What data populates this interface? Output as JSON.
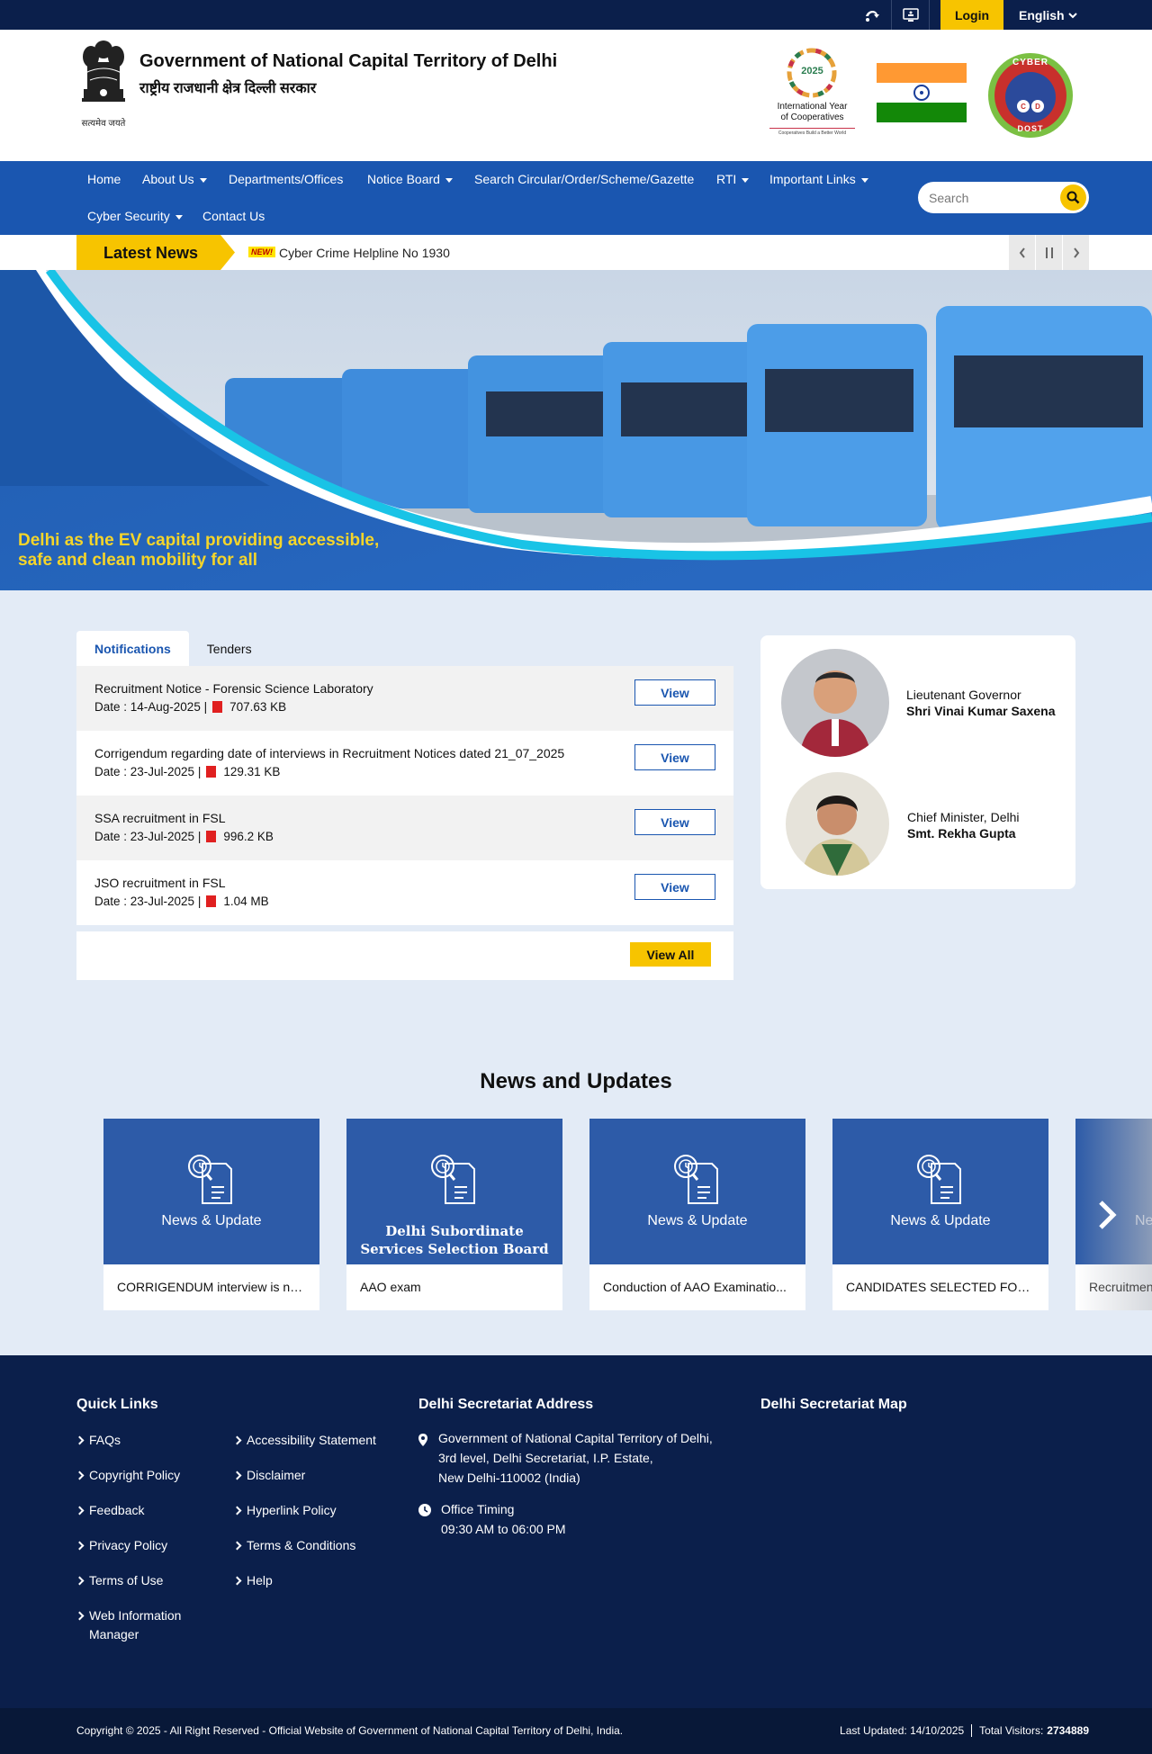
{
  "topbar": {
    "icons": [
      "screen-reader-icon",
      "accessibility-options-icon",
      "wheelchair-icon",
      "sitemap-icon"
    ],
    "login_label": "Login",
    "language_label": "English"
  },
  "header": {
    "title": "Government of National Capital Territory of Delhi",
    "subtitle": "राष्ट्रीय राजधानी क्षेत्र दिल्ली सरकार",
    "emblem_motto": "सत्यमेव जयते",
    "iyc_year": "2025",
    "iyc_title_line1": "International Year",
    "iyc_title_line2": "of Cooperatives",
    "iyc_tagline": "Cooperatives Build a Better World",
    "cyber_logo_text_top": "CYBER",
    "cyber_logo_text_bottom": "DOST"
  },
  "nav": {
    "items": [
      {
        "label": "Home",
        "has_dropdown": false
      },
      {
        "label": "About Us",
        "has_dropdown": true
      },
      {
        "label": "Departments/Offices",
        "has_dropdown": false
      },
      {
        "label": "Notice Board",
        "has_dropdown": true
      },
      {
        "label": "Search Circular/Order/Scheme/Gazette",
        "has_dropdown": false
      },
      {
        "label": "RTI",
        "has_dropdown": true
      },
      {
        "label": "Important Links",
        "has_dropdown": true
      },
      {
        "label": "Cyber Security",
        "has_dropdown": true
      },
      {
        "label": "Contact Us",
        "has_dropdown": false
      }
    ],
    "search_placeholder": "Search"
  },
  "ticker": {
    "label": "Latest News",
    "badge": "NEW!",
    "text": "Cyber Crime Helpline No 1930"
  },
  "banner": {
    "caption_line1": "Delhi as the EV capital providing accessible,",
    "caption_line2": "safe and clean mobility for all"
  },
  "notifications": {
    "tabs": [
      "Notifications",
      "Tenders"
    ],
    "active_tab": "Notifications",
    "items": [
      {
        "title": "Recruitment Notice - Forensic Science Laboratory",
        "date": "Date : 14-Aug-2025 |",
        "size": "707.63 KB",
        "action": "View"
      },
      {
        "title": "Corrigendum regarding date of interviews in Recruitment Notices dated 21_07_2025",
        "date": "Date : 23-Jul-2025 |",
        "size": "129.31 KB",
        "action": "View"
      },
      {
        "title": "SSA recruitment in FSL",
        "date": "Date : 23-Jul-2025 |",
        "size": "996.2 KB",
        "action": "View"
      },
      {
        "title": "JSO recruitment in FSL",
        "date": "Date : 23-Jul-2025 |",
        "size": "1.04 MB",
        "action": "View"
      }
    ],
    "view_all_label": "View All"
  },
  "leaders": [
    {
      "role": "Lieutenant Governor",
      "name": "Shri Vinai Kumar Saxena"
    },
    {
      "role": "Chief Minister, Delhi",
      "name": "Smt. Rekha Gupta"
    }
  ],
  "news": {
    "heading": "News and Updates",
    "cards": [
      {
        "label": "News & Update",
        "caption": "CORRIGENDUM interview is no..."
      },
      {
        "label": "Delhi Subordinate Services Selection Board",
        "caption": "AAO exam"
      },
      {
        "label": "News & Update",
        "caption": "Conduction of AAO Examinatio..."
      },
      {
        "label": "News & Update",
        "caption": "CANDIDATES SELECTED FOR..."
      },
      {
        "label": "Ne",
        "caption": "Recruitmen"
      }
    ]
  },
  "footer": {
    "quick_links_heading": "Quick Links",
    "links_col1": [
      "FAQs",
      "Copyright Policy",
      "Feedback",
      "Privacy Policy",
      "Terms of Use",
      "Web Information Manager"
    ],
    "links_col2": [
      "Accessibility Statement",
      "Disclaimer",
      "Hyperlink Policy",
      "Terms & Conditions",
      "Help"
    ],
    "address_heading": "Delhi Secretariat Address",
    "address_lines": [
      "Government of National Capital Territory of Delhi,",
      "3rd level, Delhi Secretariat, I.P. Estate,",
      "New Delhi-110002 (India)"
    ],
    "timing_label": "Office Timing",
    "timing_value": "09:30 AM to 06:00 PM",
    "map_heading": "Delhi Secretariat Map"
  },
  "bottombar": {
    "copyright": "Copyright © 2025 - All Right Reserved - Official Website of Government of National Capital Territory of Delhi, India.",
    "last_updated": "Last Updated: 14/10/2025",
    "visitors_label": "Total Visitors:",
    "visitors_value": "2734889"
  },
  "colors": {
    "navy": "#0b1f4b",
    "nav_blue": "#1a56b0",
    "accent_yellow": "#f7c400",
    "card_blue": "#2d5ba8",
    "page_bg": "#e3ebf6"
  }
}
